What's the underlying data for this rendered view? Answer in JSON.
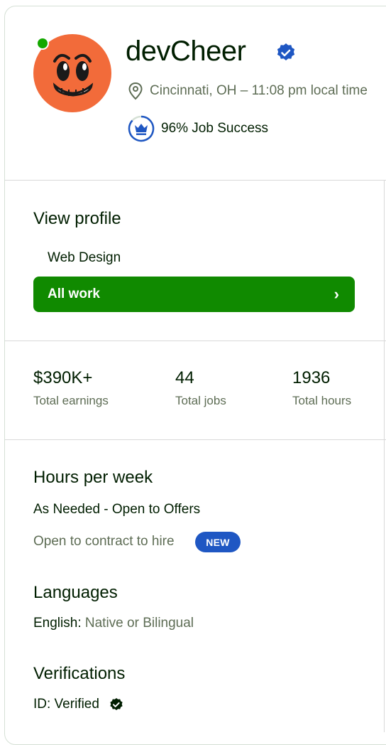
{
  "profile": {
    "name": "devCheer",
    "location": "Cincinnati, OH – 11:08 pm local time",
    "job_success": "96% Job Success"
  },
  "view_profile": {
    "title": "View profile",
    "specialty": "Web Design",
    "all_work_label": "All work",
    "chevron": "›"
  },
  "stats": [
    {
      "value": "$390K+",
      "label": "Total earnings"
    },
    {
      "value": "44",
      "label": "Total jobs"
    },
    {
      "value": "1936",
      "label": "Total hours"
    }
  ],
  "hours": {
    "title": "Hours per week",
    "value": "As Needed - Open to Offers",
    "contract": "Open to contract to hire",
    "badge": "NEW"
  },
  "languages": {
    "title": "Languages",
    "language": "English:",
    "level": "Native or Bilingual"
  },
  "verifications": {
    "title": "Verifications",
    "id_label": "ID: Verified"
  },
  "colors": {
    "brand_green": "#108a00",
    "online_green": "#14a800",
    "badge_blue": "#1f57c3",
    "verified_blue": "#1f57c3",
    "avatar_orange": "#f26b3a"
  },
  "icons": [
    "verified-badge-icon",
    "location-pin-icon",
    "crown-badge-icon",
    "chevron-right-icon",
    "check-circle-icon"
  ]
}
